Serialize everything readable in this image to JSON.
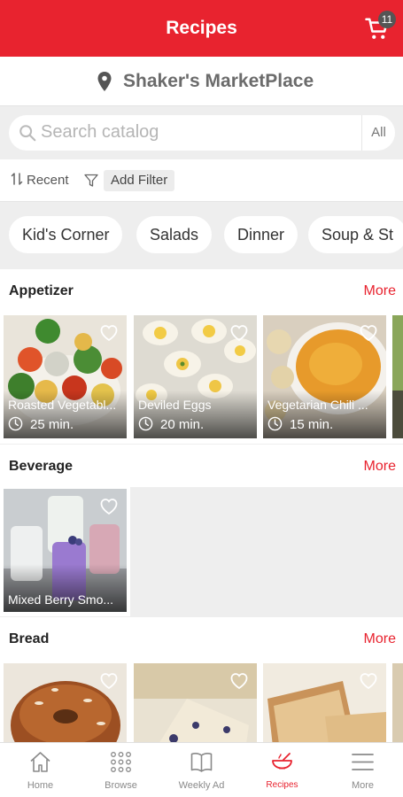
{
  "header": {
    "title": "Recipes",
    "cart_count": "11",
    "cart_icon": "shopping-cart-icon"
  },
  "store": {
    "name": "Shaker's MarketPlace",
    "icon": "location-pin-icon"
  },
  "search": {
    "placeholder": "Search catalog",
    "scope": "All"
  },
  "filters": {
    "sort_label": "Recent",
    "add_filter_label": "Add Filter"
  },
  "categories": [
    "Kid's Corner",
    "Salads",
    "Dinner",
    "Soup & St"
  ],
  "sections": [
    {
      "title": "Appetizer",
      "more": "More",
      "recipes": [
        {
          "name": "Roasted Vegetabl...",
          "time": "25 min."
        },
        {
          "name": "Deviled Eggs",
          "time": "20 min."
        },
        {
          "name": "Vegetarian Chili ...",
          "time": "15 min."
        }
      ]
    },
    {
      "title": "Beverage",
      "more": "More",
      "recipes": [
        {
          "name": "Mixed Berry Smo..."
        }
      ]
    },
    {
      "title": "Bread",
      "more": "More",
      "recipes": []
    }
  ],
  "bottom_nav": [
    {
      "label": "Home",
      "icon": "home-icon"
    },
    {
      "label": "Browse",
      "icon": "grid-dots-icon"
    },
    {
      "label": "Weekly Ad",
      "icon": "open-book-icon"
    },
    {
      "label": "Recipes",
      "icon": "bowl-icon",
      "active": true
    },
    {
      "label": "More",
      "icon": "menu-icon"
    }
  ],
  "colors": {
    "brand": "#e8232f",
    "background": "#eeeeee"
  }
}
